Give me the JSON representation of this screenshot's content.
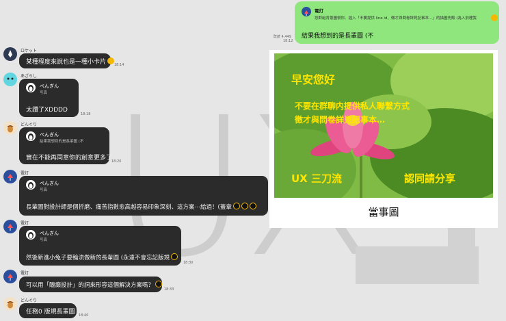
{
  "watermark": "UX",
  "top_right": {
    "quote_name": "電灯",
    "quote_text": "您群組背景圖很你、插入「不要提供 line id、微才與問卷詳見記事本…」的描圖先販 (為入別理我",
    "reply_text": "結果我想到的是長輩圖 (不",
    "read_status": "既読 4,449",
    "time": "18:12"
  },
  "photo": {
    "line1": "早安您好",
    "line2": "不要在群聊内提供私人聯繫方式",
    "line3": "徵才與問卷詳見記事本…",
    "line4_left": "UX 三刀流",
    "line4_right": "認同請分享",
    "caption": "當事圖"
  },
  "messages": [
    {
      "sender": "ロケット",
      "text": "某種程度來說也是一種小卡片",
      "time": "18:14"
    },
    {
      "sender": "あざらし",
      "quote_name": "ぺんぎん",
      "quote_text": "写真",
      "text": "太讚了XDDDD",
      "time": "18:18"
    },
    {
      "sender": "どんぐり",
      "quote_name": "ぺんぎん",
      "quote_text": "結果我想到的是長輩圖 (不",
      "text": "實在不能再同意你的創意更多了",
      "time": "18:20"
    },
    {
      "sender": "電灯",
      "quote_name": "ぺんぎん",
      "quote_text": "写真",
      "text": "長輩圖對設計師是個折磨、痛苦指數愈高越容易印象深刻、這方案⋯給過！(蓋章",
      "time": ""
    },
    {
      "sender": "電灯",
      "quote_name": "ぺんぎん",
      "quote_text": "写真",
      "text": "然後新進小兔子要輪流做新的長輩圖 (永遠不會忘記版規",
      "time": "18:30"
    },
    {
      "sender": "電灯",
      "text": "可以用「醜癲設計」的詞來形容這個解決方案嗎？",
      "time": "18:33"
    },
    {
      "sender": "どんぐり",
      "text": "任務0 版規長輩圖",
      "time": "18:40"
    }
  ],
  "colors": {
    "background": "#e6e6e6",
    "bubble_dark": "#2b2b2b",
    "bubble_green": "#8ee67d",
    "emoji": "#f5b800"
  }
}
